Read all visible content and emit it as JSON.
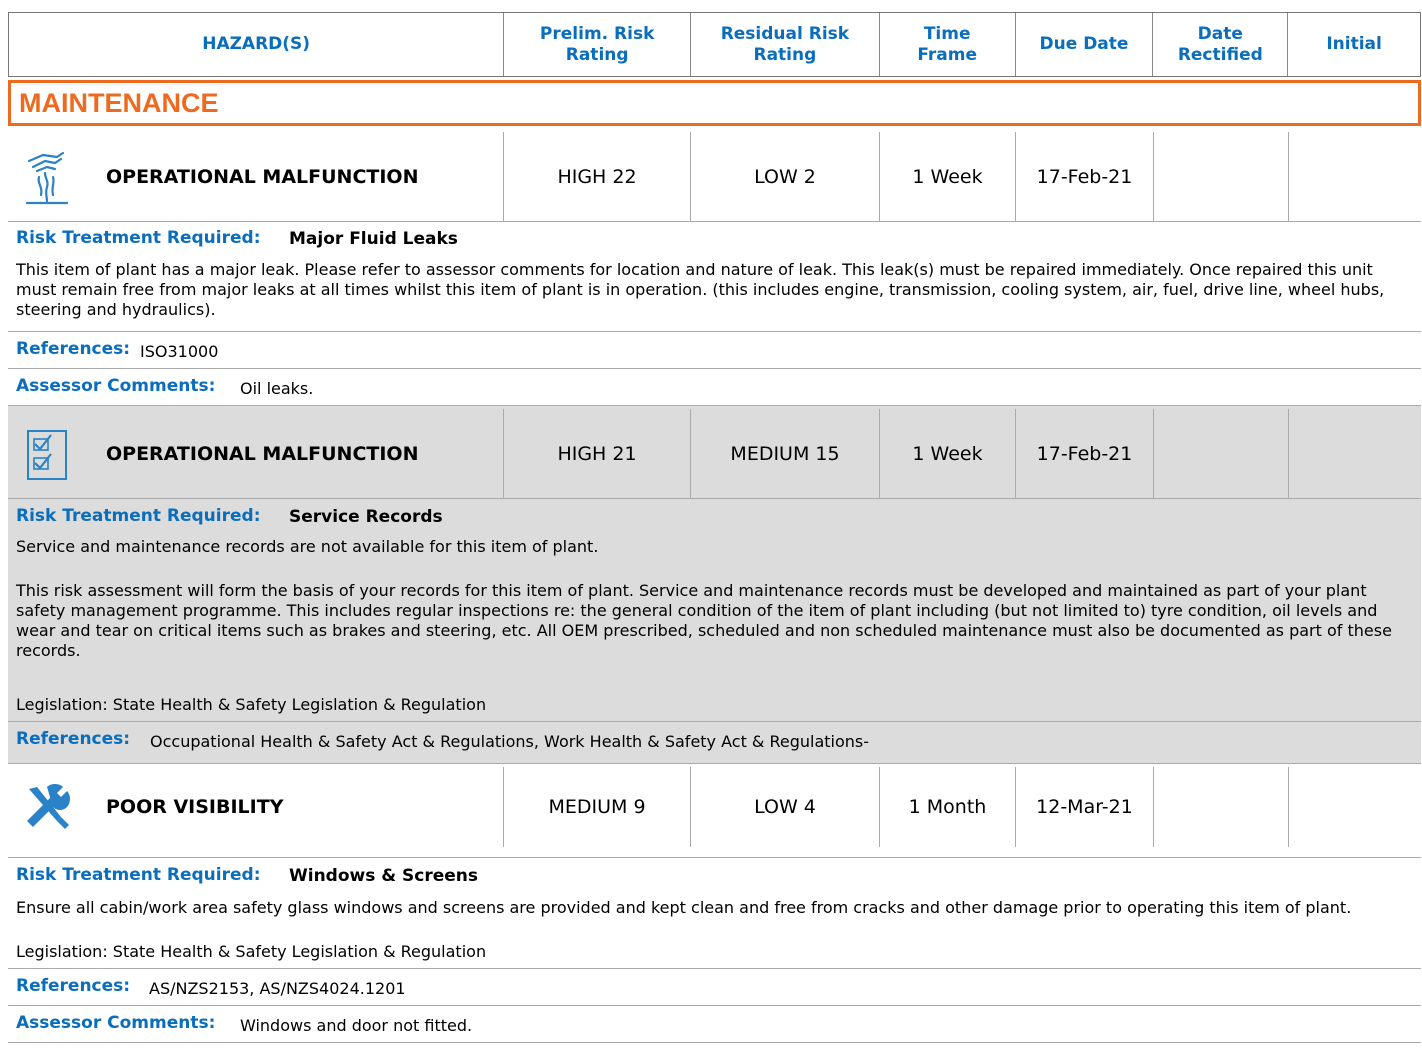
{
  "header": {
    "hazards": "HAZARD(S)",
    "prelim_line1": "Prelim. Risk",
    "prelim_line2": "Rating",
    "residual_line1": "Residual Risk",
    "residual_line2": "Rating",
    "time_line1": "Time",
    "time_line2": "Frame",
    "due": "Due Date",
    "rect_line1": "Date",
    "rect_line2": "Rectified",
    "initial": "Initial"
  },
  "section_title": "MAINTENANCE",
  "labels": {
    "risk_treatment": "Risk Treatment Required:",
    "references": "References:",
    "assessor": "Assessor Comments:"
  },
  "hazards": [
    {
      "icon": "leak-icon",
      "title": "OPERATIONAL MALFUNCTION",
      "prelim": "HIGH 22",
      "residual": "LOW 2",
      "time": "1 Week",
      "due": "17-Feb-21",
      "rectified": "",
      "initial": "",
      "treatment": "Major Fluid Leaks",
      "description": "This item of plant has a major leak. Please refer to assessor comments for location and nature of leak. This leak(s) must be repaired immediately. Once repaired this unit must remain free from major leaks at all times whilst this item of plant is in operation. (this includes engine, transmission, cooling system, air, fuel, drive line, wheel hubs, steering and hydraulics).",
      "references": "ISO31000",
      "assessor_comments": "Oil leaks."
    },
    {
      "icon": "checklist-icon",
      "title": "OPERATIONAL MALFUNCTION",
      "prelim": "HIGH 21",
      "residual": "MEDIUM 15",
      "time": "1 Week",
      "due": "17-Feb-21",
      "rectified": "",
      "initial": "",
      "treatment": "Service Records",
      "description_1": "Service and maintenance records are not available for this item of plant.",
      "description_2": "This risk assessment will form the basis of your records for this item of plant. Service and maintenance records must be developed and maintained as part of your plant safety management programme. This includes regular inspections re: the general condition of the item of plant including (but not limited to) tyre condition, oil levels and wear and tear on critical items such as brakes and steering, etc. All OEM prescribed, scheduled and non scheduled maintenance must also be documented as part of these records.",
      "legislation": "Legislation: State Health & Safety Legislation & Regulation",
      "references": "Occupational Health & Safety Act & Regulations, Work Health & Safety Act & Regulations-"
    },
    {
      "icon": "tools-icon",
      "title": "POOR VISIBILITY",
      "prelim": "MEDIUM 9",
      "residual": "LOW 4",
      "time": "1 Month",
      "due": "12-Mar-21",
      "rectified": "",
      "initial": "",
      "treatment": "Windows & Screens",
      "description": "Ensure all cabin/work area safety glass windows and screens are provided and kept clean and free from cracks and other damage prior to operating this item of plant.",
      "legislation": "Legislation: State Health & Safety Legislation & Regulation",
      "references": "AS/NZS2153, AS/NZS4024.1201",
      "assessor_comments": "Windows and door not fitted."
    }
  ]
}
